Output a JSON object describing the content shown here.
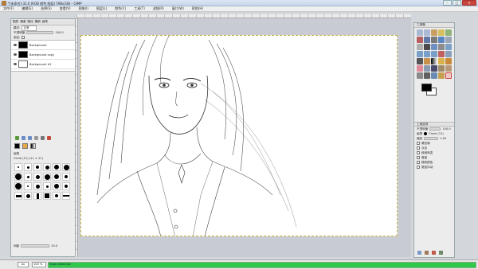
{
  "window": {
    "title": "*[未命名]-31.0 (RGB 颜色 图层) 598x338 – GIMP",
    "minimize": "–",
    "maximize": "□",
    "close": "✕"
  },
  "menu": [
    "文件(F)",
    "编辑(E)",
    "选择(S)",
    "查看(V)",
    "图像(I)",
    "图层(L)",
    "颜色(C)",
    "工具(T)",
    "滤镜(R)",
    "窗口(W)",
    "帮助(H)"
  ],
  "left_dock": {
    "tabs": [
      "图层",
      "通道",
      "路径",
      "撤销",
      "画笔"
    ],
    "mode_label": "模式:",
    "mode_value": "正常",
    "opacity_label": "不透明度",
    "opacity_value": "100.0",
    "lock_label": "锁定:",
    "layers": [
      {
        "name": "Background",
        "thumb": "#000000"
      },
      {
        "name": "Background copy",
        "thumb": "#000000"
      },
      {
        "name": "Background #1",
        "thumb": "#ffffff"
      }
    ],
    "brushes_title": "画笔",
    "brush_name": "Circle (11) (11 × 11)",
    "spacing_label": "间距",
    "spacing_value": "20.0"
  },
  "toolbox": {
    "title": "工具箱",
    "options_title": "工具选项",
    "opacity_label": "不透明度",
    "opacity_value": "100.0",
    "brush_label": "画笔",
    "brush_value": "Circle (11)",
    "scale_label": "缩放",
    "scale_value": "1.00",
    "options": [
      "硬边缘",
      "淡出",
      "使用渐变",
      "增量",
      "随机颜色",
      "施加抖动"
    ]
  },
  "status": {
    "unit": "px",
    "zoom": "100 %",
    "progress_text": "Edge detection",
    "progress_fraction": 1.0
  },
  "colors": {
    "progress": "#2ec94a",
    "foreground": "#000000",
    "background": "#ffffff"
  }
}
